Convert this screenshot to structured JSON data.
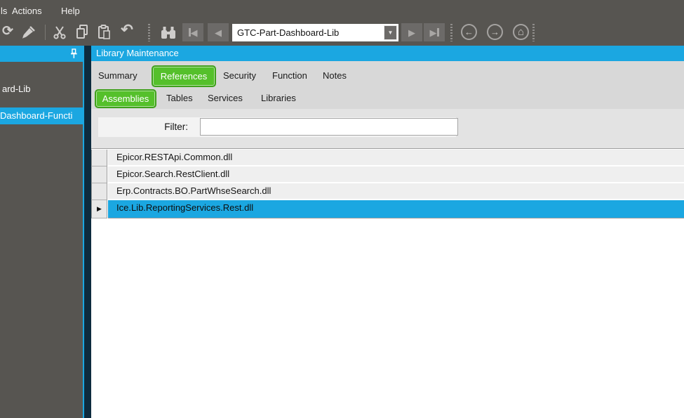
{
  "menubar": {
    "items": [
      {
        "label": "ls"
      },
      {
        "label": "Actions"
      },
      {
        "label": "Help"
      }
    ]
  },
  "toolbar": {
    "record_selector": {
      "value": "GTC-Part-Dashboard-Lib"
    }
  },
  "glyphs": {
    "refresh": "⟳",
    "undo": "↶",
    "triangle_left": "◀",
    "triangle_right": "▶",
    "arrow_left": "←",
    "arrow_right": "→",
    "home": "⌂",
    "dropdown": "▼",
    "row_indicator": "▶"
  },
  "sidebar": {
    "items": [
      {
        "label": "ard-Lib",
        "selected": false
      },
      {
        "label": "Dashboard-Functi",
        "selected": true
      }
    ]
  },
  "main": {
    "title": "Library Maintenance",
    "tabs": [
      {
        "label": "Summary",
        "selected": false
      },
      {
        "label": "References",
        "selected": true
      },
      {
        "label": "Security",
        "selected": false
      },
      {
        "label": "Function",
        "selected": false
      },
      {
        "label": "Notes",
        "selected": false
      }
    ],
    "subtabs": [
      {
        "label": "Assemblies",
        "selected": true
      },
      {
        "label": "Tables",
        "selected": false
      },
      {
        "label": "Services",
        "selected": false
      },
      {
        "label": "Libraries",
        "selected": false
      }
    ],
    "filter": {
      "label": "Filter:",
      "value": ""
    },
    "grid": {
      "rows": [
        {
          "text": "Epicor.RESTApi.Common.dll",
          "selected": false
        },
        {
          "text": "Epicor.Search.RestClient.dll",
          "selected": false
        },
        {
          "text": "Erp.Contracts.BO.PartWhseSearch.dll",
          "selected": false
        },
        {
          "text": "Ice.Lib.ReportingServices.Rest.dll",
          "selected": true
        }
      ]
    }
  },
  "colors": {
    "accent_blue": "#1BA7E1",
    "accent_green": "#55C02B",
    "chrome_dark": "#575551",
    "divider_navy": "#0D2B3E"
  }
}
